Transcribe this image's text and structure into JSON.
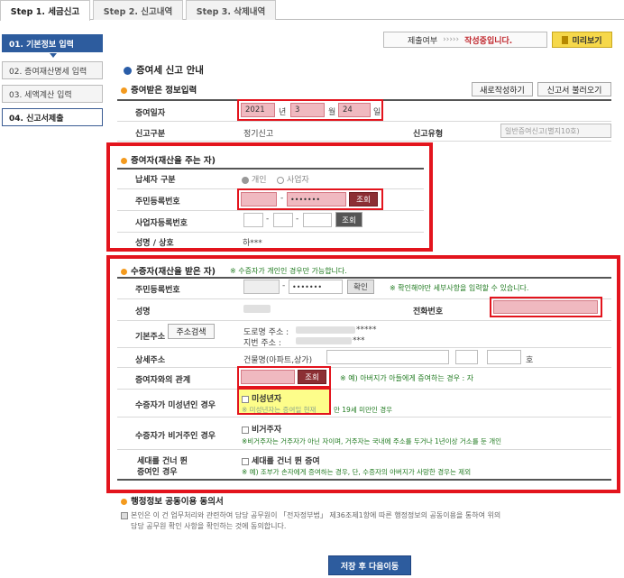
{
  "tabs": [
    "Step 1. 세금신고",
    "Step 2. 신고내역",
    "Step 3. 삭제내역"
  ],
  "sidebar": {
    "items": [
      "01. 기본정보 입력",
      "02. 증여재산명세 입력",
      "03. 세액계산 입력",
      "04. 신고서제출"
    ]
  },
  "status": {
    "label": "제출여부",
    "arrows": "›››››",
    "value": "작성중입니다.",
    "preview": "미리보기"
  },
  "main": {
    "title": "증여세 신고 안내",
    "received": {
      "title": "증여받은 정보입력",
      "new_btn": "새로작성하기",
      "load_btn": "신고서 불러오기",
      "date_label": "증여일자",
      "year": "2021",
      "year_unit": "년",
      "month": "3",
      "month_unit": "월",
      "day": "24",
      "day_unit": "일",
      "type_label": "신고구분",
      "type_value": "정기신고",
      "kind_label": "신고유형",
      "kind_value": "일반증여신고(별지10호)"
    },
    "giver": {
      "title": "증여자(재산을 주는 자)",
      "tax_label": "납세자 구분",
      "individual": "개인",
      "business": "사업자",
      "rrn_label": "주민등록번호",
      "rrn_back": "•••••••",
      "lookup": "조회",
      "brn_label": "사업자등록번호",
      "name_label": "성명 / 상호",
      "name_value": "하***"
    },
    "receiver": {
      "title": "수증자(재산을 받은 자)",
      "title_note": "※ 수증자가 개인인 경우만 가능합니다.",
      "rrn_label": "주민등록번호",
      "rrn_back": "•••••••",
      "confirm": "확인",
      "confirm_note": "※ 확인해야만 세부사항을 입력할 수 있습니다.",
      "name_label": "성명",
      "phone_label": "전화번호",
      "addr_label": "기본주소",
      "addr_btn": "주소검색",
      "road": "도로명 주소 :",
      "road_tail": "*****",
      "jibun": "지번 주소 :",
      "jibun_tail": "***",
      "detail_label": "상세주소",
      "detail_value": "건물명(아파트,상가)",
      "ho": "호",
      "relation_label": "증여자와의 관계",
      "relation_lookup": "조회",
      "relation_note": "※ 예) 아버지가 아들에게 증여하는 경우 : 자",
      "minor_label": "수증자가 미성년인 경우",
      "minor_check": "미성년자",
      "minor_note": "※ 미성년자는 증여일 현재",
      "minor_note2": "만 19세 미만인 경우",
      "nonres_label": "수증자가 비거주인 경우",
      "nonres_check": "비거주자",
      "nonres_note": "※비거주자는 거주자가 아닌 자이며, 거주자는 국내에 주소를 두거나 1년이상 거소를 둔 개인",
      "skip_label1": "세대를 건너 뛴",
      "skip_label2": "증여인 경우",
      "skip_check": "세대를 건너 뛴 증여",
      "skip_note": "※ 예) 조부가 손자에게 증여하는 경우, 단, 수증자의 아버지가 사망한 경우는 제외"
    },
    "consent": {
      "title": "행정정보 공동이용 동의서",
      "text1": "본인은 이 건 업무처리와 관련하여 담당 공무원이 「전자정부법」 제36조제1항에 따른 행정정보의 공동이용을 통하여 위의",
      "text2": "담당 공무원 확인 사항을 확인하는 것에 동의합니다."
    },
    "save_btn": "저장 후 다음이동"
  }
}
